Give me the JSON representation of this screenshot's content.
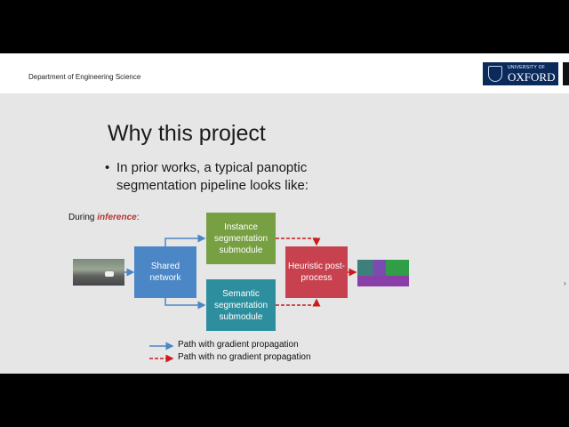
{
  "header": {
    "department": "Department of Engineering Science",
    "logo_university": "UNIVERSITY OF",
    "logo_name": "OXFORD"
  },
  "slide": {
    "title": "Why this project",
    "bullet": "In prior works, a typical panoptic segmentation pipeline looks like:",
    "inference_prefix": "During ",
    "inference_emphasis": "inference",
    "inference_suffix": ":"
  },
  "diagram": {
    "shared": "Shared network",
    "instance": "Instance segmentation submodule",
    "semantic": "Semantic segmentation submodule",
    "heuristic": "Heuristic post-process"
  },
  "legend": {
    "gradient": "Path with gradient propagation",
    "no_gradient": "Path with no gradient propagation"
  },
  "colors": {
    "shared": "#4b86c6",
    "instance": "#77a043",
    "semantic": "#2d8f9e",
    "heuristic": "#c7424e",
    "gradient_arrow": "#4b86c6",
    "no_gradient_arrow": "#cc1b1b"
  }
}
